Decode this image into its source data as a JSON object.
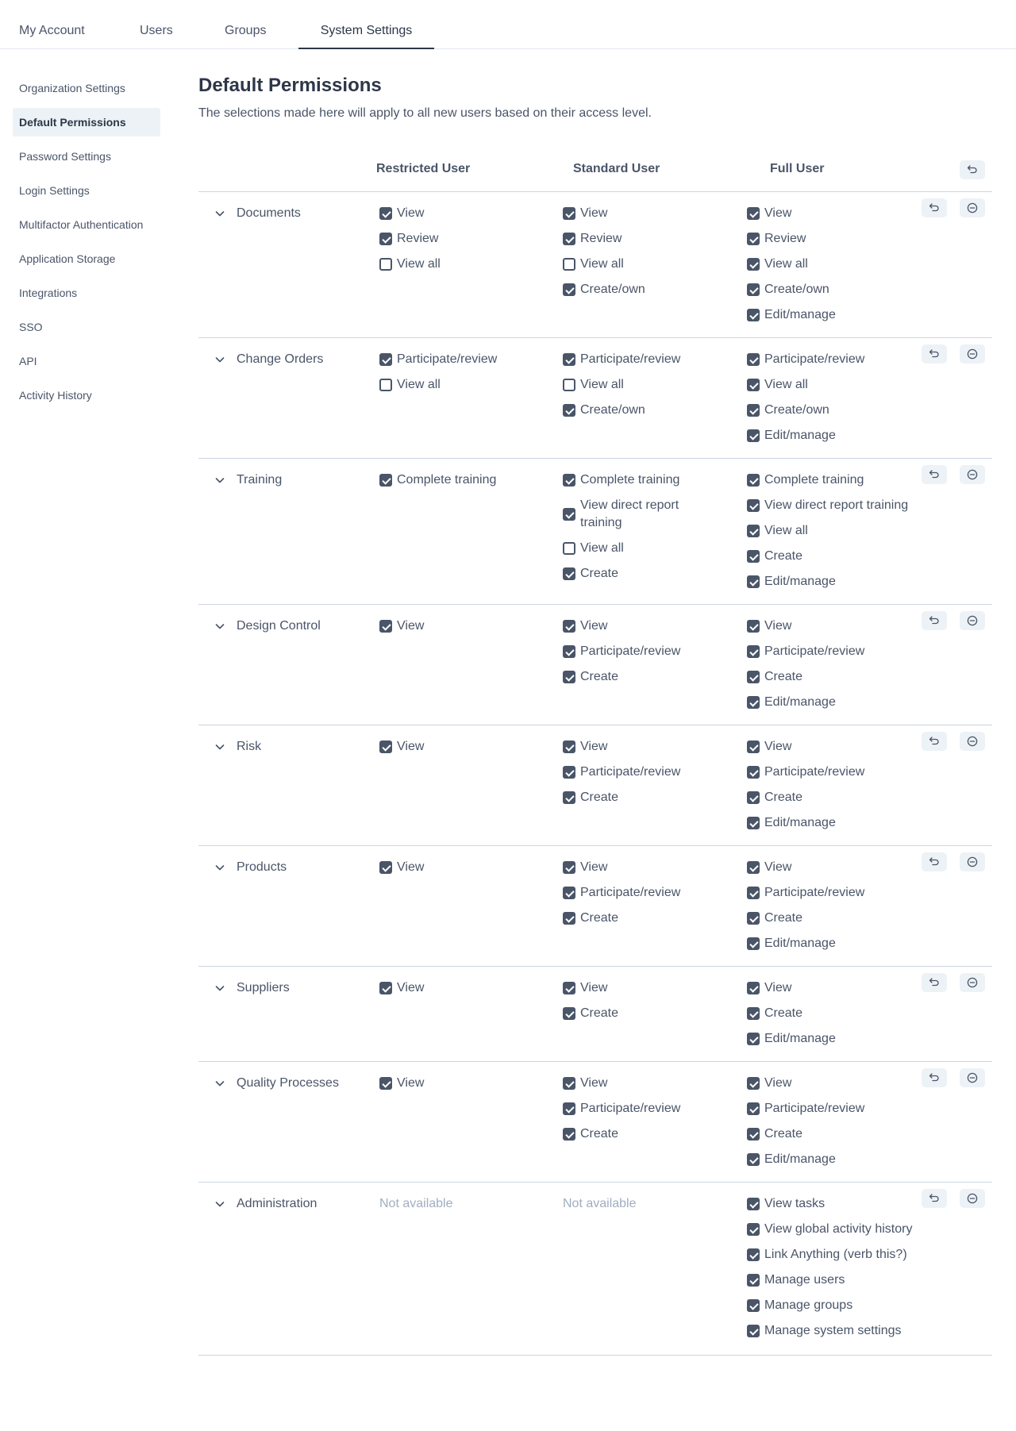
{
  "tabs": [
    "My Account",
    "Users",
    "Groups",
    "System Settings"
  ],
  "sidebar": [
    "Organization Settings",
    "Default Permissions",
    "Password Settings",
    "Login Settings",
    "Multifactor Authentication",
    "Application Storage",
    "Integrations",
    "SSO",
    "API",
    "Activity History"
  ],
  "page": {
    "title": "Default Permissions",
    "description": "The selections made here will apply to all new users based on their access level."
  },
  "columns": [
    "Restricted User",
    "Standard User",
    "Full User"
  ],
  "sections": [
    {
      "name": "Documents",
      "restricted": [
        {
          "label": "View",
          "checked": true
        },
        {
          "label": "Review",
          "checked": true
        },
        {
          "label": "View all",
          "checked": false
        }
      ],
      "standard": [
        {
          "label": "View",
          "checked": true
        },
        {
          "label": "Review",
          "checked": true
        },
        {
          "label": "View all",
          "checked": false
        },
        {
          "label": "Create/own",
          "checked": true
        }
      ],
      "full": [
        {
          "label": "View",
          "checked": true
        },
        {
          "label": "Review",
          "checked": true
        },
        {
          "label": "View all",
          "checked": true
        },
        {
          "label": "Create/own",
          "checked": true
        },
        {
          "label": "Edit/manage",
          "checked": true
        }
      ]
    },
    {
      "name": "Change Orders",
      "restricted": [
        {
          "label": "Participate/review",
          "checked": true
        },
        {
          "label": "View all",
          "checked": false
        }
      ],
      "standard": [
        {
          "label": "Participate/review",
          "checked": true
        },
        {
          "label": "View all",
          "checked": false
        },
        {
          "label": "Create/own",
          "checked": true
        }
      ],
      "full": [
        {
          "label": "Participate/review",
          "checked": true
        },
        {
          "label": "View all",
          "checked": true
        },
        {
          "label": "Create/own",
          "checked": true
        },
        {
          "label": "Edit/manage",
          "checked": true
        }
      ]
    },
    {
      "name": "Training",
      "restricted": [
        {
          "label": "Complete training",
          "checked": true
        }
      ],
      "standard": [
        {
          "label": "Complete training",
          "checked": true
        },
        {
          "label": "View direct report training",
          "checked": true
        },
        {
          "label": "View all",
          "checked": false
        },
        {
          "label": "Create",
          "checked": true
        }
      ],
      "full": [
        {
          "label": "Complete training",
          "checked": true
        },
        {
          "label": "View direct report training",
          "checked": true
        },
        {
          "label": "View all",
          "checked": true
        },
        {
          "label": "Create",
          "checked": true
        },
        {
          "label": "Edit/manage",
          "checked": true
        }
      ]
    },
    {
      "name": "Design Control",
      "restricted": [
        {
          "label": "View",
          "checked": true
        }
      ],
      "standard": [
        {
          "label": "View",
          "checked": true
        },
        {
          "label": "Participate/review",
          "checked": true
        },
        {
          "label": "Create",
          "checked": true
        }
      ],
      "full": [
        {
          "label": "View",
          "checked": true
        },
        {
          "label": "Participate/review",
          "checked": true
        },
        {
          "label": "Create",
          "checked": true
        },
        {
          "label": "Edit/manage",
          "checked": true
        }
      ]
    },
    {
      "name": "Risk",
      "restricted": [
        {
          "label": "View",
          "checked": true
        }
      ],
      "standard": [
        {
          "label": "View",
          "checked": true
        },
        {
          "label": "Participate/review",
          "checked": true
        },
        {
          "label": "Create",
          "checked": true
        }
      ],
      "full": [
        {
          "label": "View",
          "checked": true
        },
        {
          "label": "Participate/review",
          "checked": true
        },
        {
          "label": "Create",
          "checked": true
        },
        {
          "label": "Edit/manage",
          "checked": true
        }
      ]
    },
    {
      "name": "Products",
      "restricted": [
        {
          "label": "View",
          "checked": true
        }
      ],
      "standard": [
        {
          "label": "View",
          "checked": true
        },
        {
          "label": "Participate/review",
          "checked": true
        },
        {
          "label": "Create",
          "checked": true
        }
      ],
      "full": [
        {
          "label": "View",
          "checked": true
        },
        {
          "label": "Participate/review",
          "checked": true
        },
        {
          "label": "Create",
          "checked": true
        },
        {
          "label": "Edit/manage",
          "checked": true
        }
      ]
    },
    {
      "name": "Suppliers",
      "restricted": [
        {
          "label": "View",
          "checked": true
        }
      ],
      "standard": [
        {
          "label": "View",
          "checked": true
        },
        {
          "label": "Create",
          "checked": true
        }
      ],
      "full": [
        {
          "label": "View",
          "checked": true
        },
        {
          "label": "Create",
          "checked": true
        },
        {
          "label": "Edit/manage",
          "checked": true
        }
      ]
    },
    {
      "name": "Quality Processes",
      "restricted": [
        {
          "label": "View",
          "checked": true
        }
      ],
      "standard": [
        {
          "label": "View",
          "checked": true
        },
        {
          "label": "Participate/review",
          "checked": true
        },
        {
          "label": "Create",
          "checked": true
        }
      ],
      "full": [
        {
          "label": "View",
          "checked": true
        },
        {
          "label": "Participate/review",
          "checked": true
        },
        {
          "label": "Create",
          "checked": true
        },
        {
          "label": "Edit/manage",
          "checked": true
        }
      ]
    },
    {
      "name": "Administration",
      "restricted_note": "Not available",
      "standard_note": "Not available",
      "restricted": [],
      "standard": [],
      "full": [
        {
          "label": "View tasks",
          "checked": true
        },
        {
          "label": "View global activity history",
          "checked": true
        },
        {
          "label": "Link Anything (verb this?)",
          "checked": true
        },
        {
          "label": "Manage users",
          "checked": true
        },
        {
          "label": "Manage groups",
          "checked": true
        },
        {
          "label": "Manage system settings",
          "checked": true
        }
      ]
    }
  ],
  "icons": {
    "reset": "undo-icon",
    "remove": "minus-circle-icon",
    "expand": "chevron-down-icon"
  },
  "colors": {
    "text": "#4a5568",
    "heading": "#2d3748",
    "muted": "#a0aec0",
    "divider": "#cbd5e0",
    "active_bg": "#edf2f7"
  }
}
